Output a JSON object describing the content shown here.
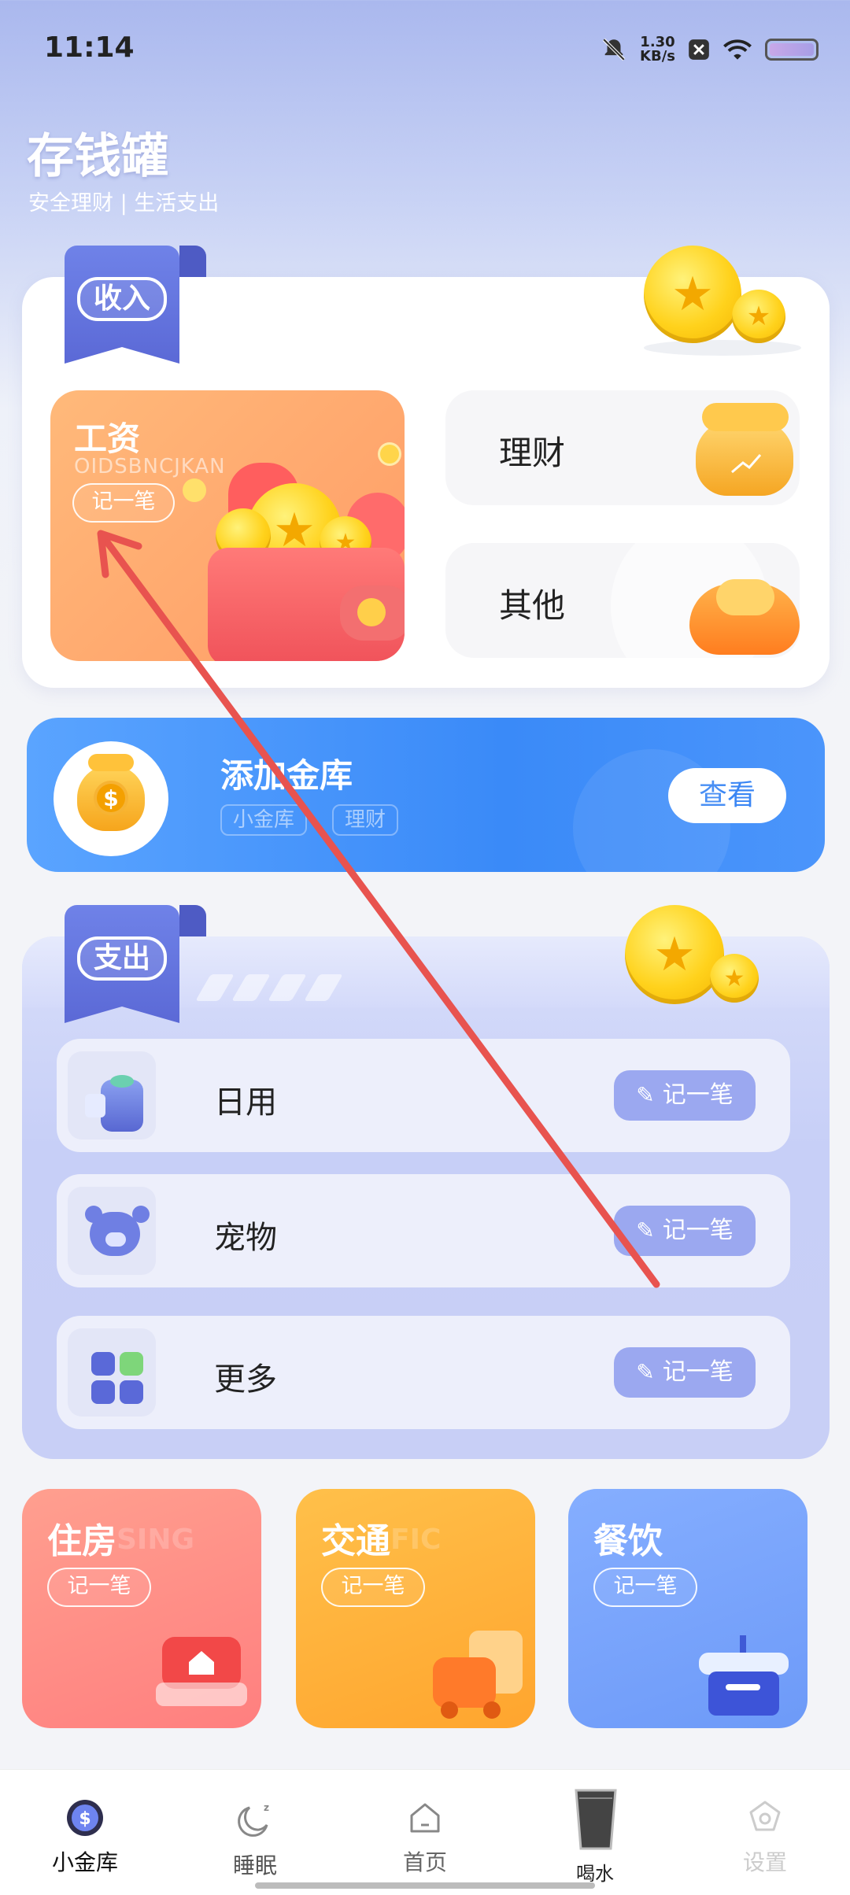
{
  "status_bar": {
    "time": "11:14",
    "net_speed_value": "1.30",
    "net_speed_unit": "KB/s"
  },
  "header": {
    "title": "存钱罐",
    "subtitle": "安全理财 | 生活支出"
  },
  "income": {
    "badge": "收入",
    "salary": {
      "title": "工资",
      "subtitle_en": "OIDSBNCJKAN",
      "record": "记一笔"
    },
    "invest": {
      "label": "理财"
    },
    "other": {
      "label": "其他"
    }
  },
  "vault": {
    "title": "添加金库",
    "tags": [
      "小金库",
      "理财"
    ],
    "view_button": "查看"
  },
  "expense": {
    "badge": "支出",
    "rows": [
      {
        "label": "日用",
        "record": "记一笔"
      },
      {
        "label": "宠物",
        "record": "记一笔"
      },
      {
        "label": "更多",
        "record": "记一笔"
      }
    ]
  },
  "categories": [
    {
      "title": "住房",
      "en": "SING",
      "record": "记一笔",
      "color": "#ff8c86"
    },
    {
      "title": "交通",
      "en": "FIC",
      "record": "记一笔",
      "color": "#ffae3a"
    },
    {
      "title": "餐饮",
      "en": "",
      "record": "记一笔",
      "color": "#7aa6ff"
    }
  ],
  "bottom_nav": [
    {
      "label": "小金库",
      "active": true,
      "icon": "dollar-coin-icon"
    },
    {
      "label": "睡眠",
      "active": false,
      "icon": "moon-icon"
    },
    {
      "label": "首页",
      "active": false,
      "icon": "home-icon"
    },
    {
      "label": "喝水",
      "active": false,
      "icon": "cup-icon"
    },
    {
      "label": "设置",
      "active": false,
      "icon": "gear-icon"
    }
  ],
  "colors": {
    "accent_blue": "#3a8af8",
    "income_badge": "#5b69d6",
    "annotation_arrow": "#e8534f"
  }
}
